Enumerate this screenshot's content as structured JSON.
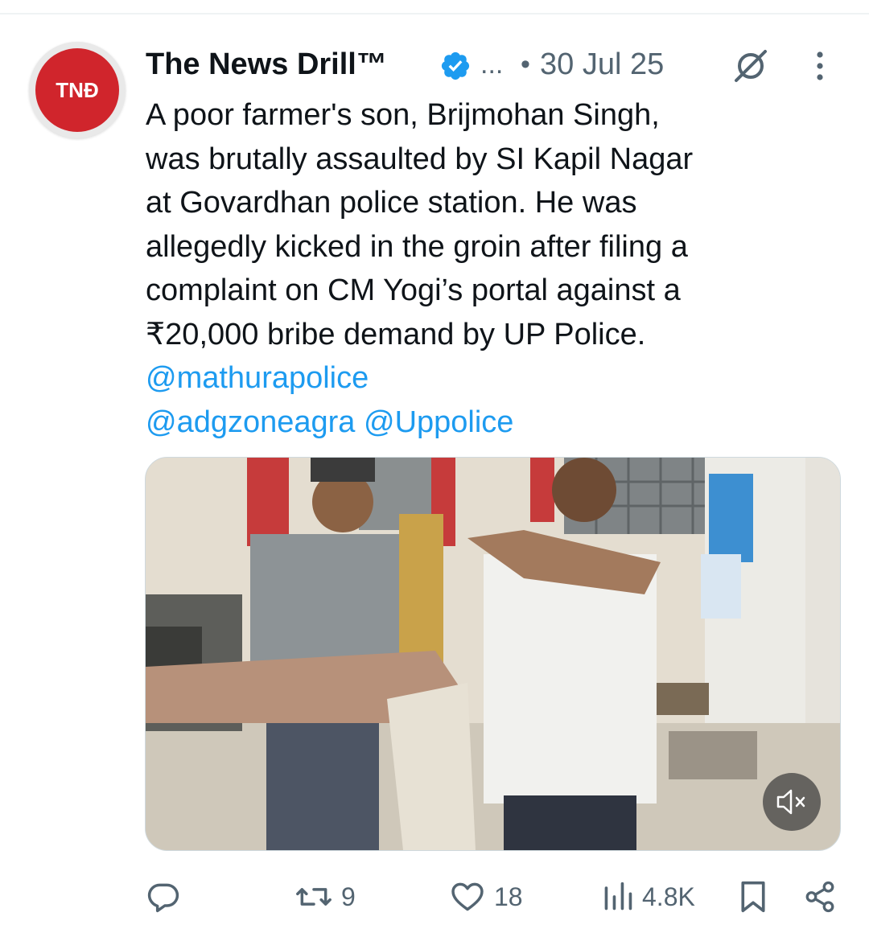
{
  "tweet": {
    "avatar_text": "TNĐ",
    "display_name": "The News Drill™",
    "handle_ellipsis": "...",
    "dot": "•",
    "timestamp": "30 Jul 25",
    "text_lines": [
      "A poor farmer's son, Brijmohan Singh,",
      "was brutally assaulted by SI Kapil Nagar",
      "at Govardhan police station. He was",
      "allegedly kicked in the groin after filing a",
      "complaint on CM Yogi’s portal against a",
      "₹20,000 bribe demand by UP Police."
    ],
    "mentions": {
      "m1": "@mathurapolice",
      "m2": "@adgzoneagra",
      "m3": "@Uppolice"
    }
  },
  "actions": {
    "replies_count": "",
    "retweets_count": "9",
    "likes_count": "18",
    "views_count": "4.8K"
  },
  "icons": {
    "verified": "verified-badge-icon",
    "grok": "grok-icon",
    "more": "more-vertical-icon",
    "reply": "reply-icon",
    "retweet": "retweet-icon",
    "like": "heart-icon",
    "views": "views-bar-icon",
    "bookmark": "bookmark-icon",
    "share": "share-icon",
    "mute": "volume-muted-icon"
  },
  "colors": {
    "accent": "#1d9bf0",
    "text": "#0f1419",
    "secondary": "#536471",
    "avatar_red": "#d0252c"
  }
}
